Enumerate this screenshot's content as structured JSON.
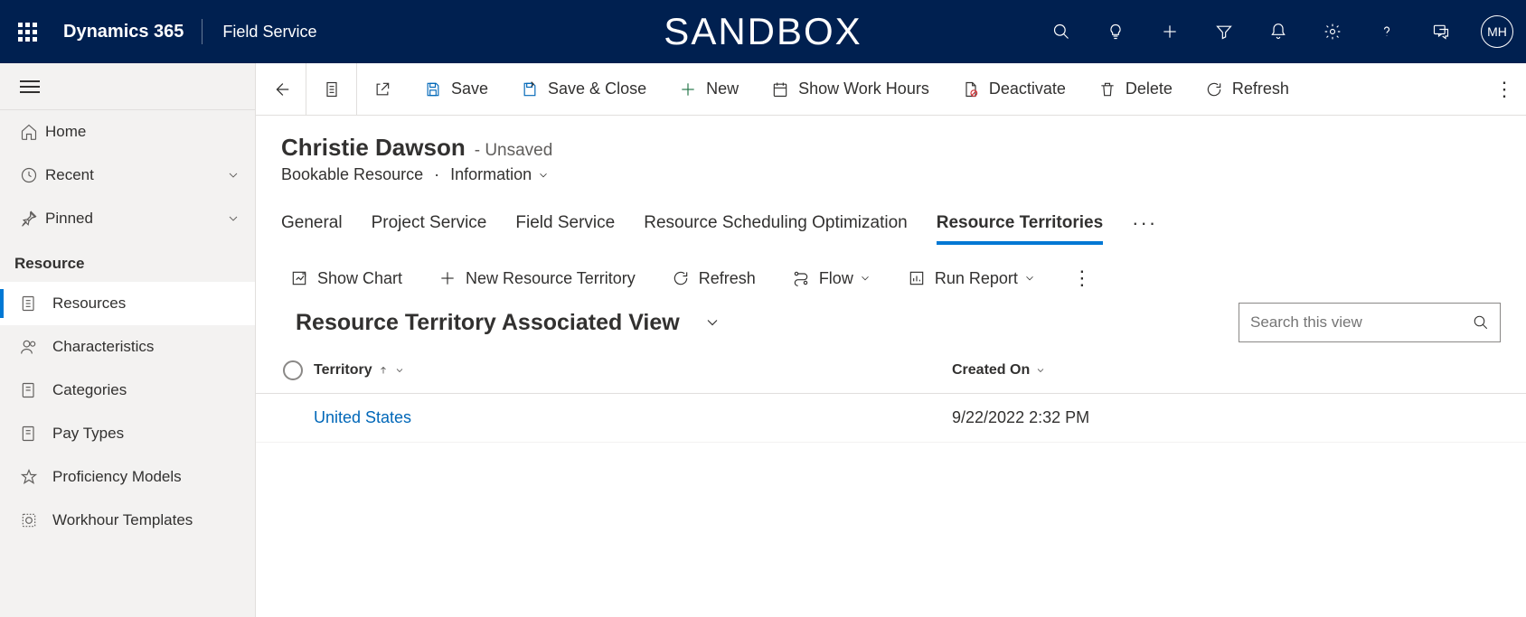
{
  "topbar": {
    "brand": "Dynamics 365",
    "app": "Field Service",
    "env": "SANDBOX",
    "avatar": "MH"
  },
  "sidebar": {
    "home": "Home",
    "recent": "Recent",
    "pinned": "Pinned",
    "section": "Resource",
    "items": [
      "Resources",
      "Characteristics",
      "Categories",
      "Pay Types",
      "Proficiency Models",
      "Workhour Templates"
    ]
  },
  "commands": {
    "save": "Save",
    "saveclose": "Save & Close",
    "new": "New",
    "workhours": "Show Work Hours",
    "deactivate": "Deactivate",
    "delete": "Delete",
    "refresh": "Refresh"
  },
  "record": {
    "title": "Christie Dawson",
    "status": "- Unsaved",
    "entity": "Bookable Resource",
    "form": "Information"
  },
  "tabs": {
    "general": "General",
    "project": "Project Service",
    "field": "Field Service",
    "rso": "Resource Scheduling Optimization",
    "territories": "Resource Territories"
  },
  "subgrid_cmds": {
    "showchart": "Show Chart",
    "new": "New Resource Territory",
    "refresh": "Refresh",
    "flow": "Flow",
    "report": "Run Report"
  },
  "view": {
    "title": "Resource Territory Associated View",
    "search_placeholder": "Search this view"
  },
  "grid": {
    "col_territory": "Territory",
    "col_created": "Created On",
    "rows": [
      {
        "territory": "United States",
        "created": "9/22/2022 2:32 PM"
      }
    ]
  }
}
